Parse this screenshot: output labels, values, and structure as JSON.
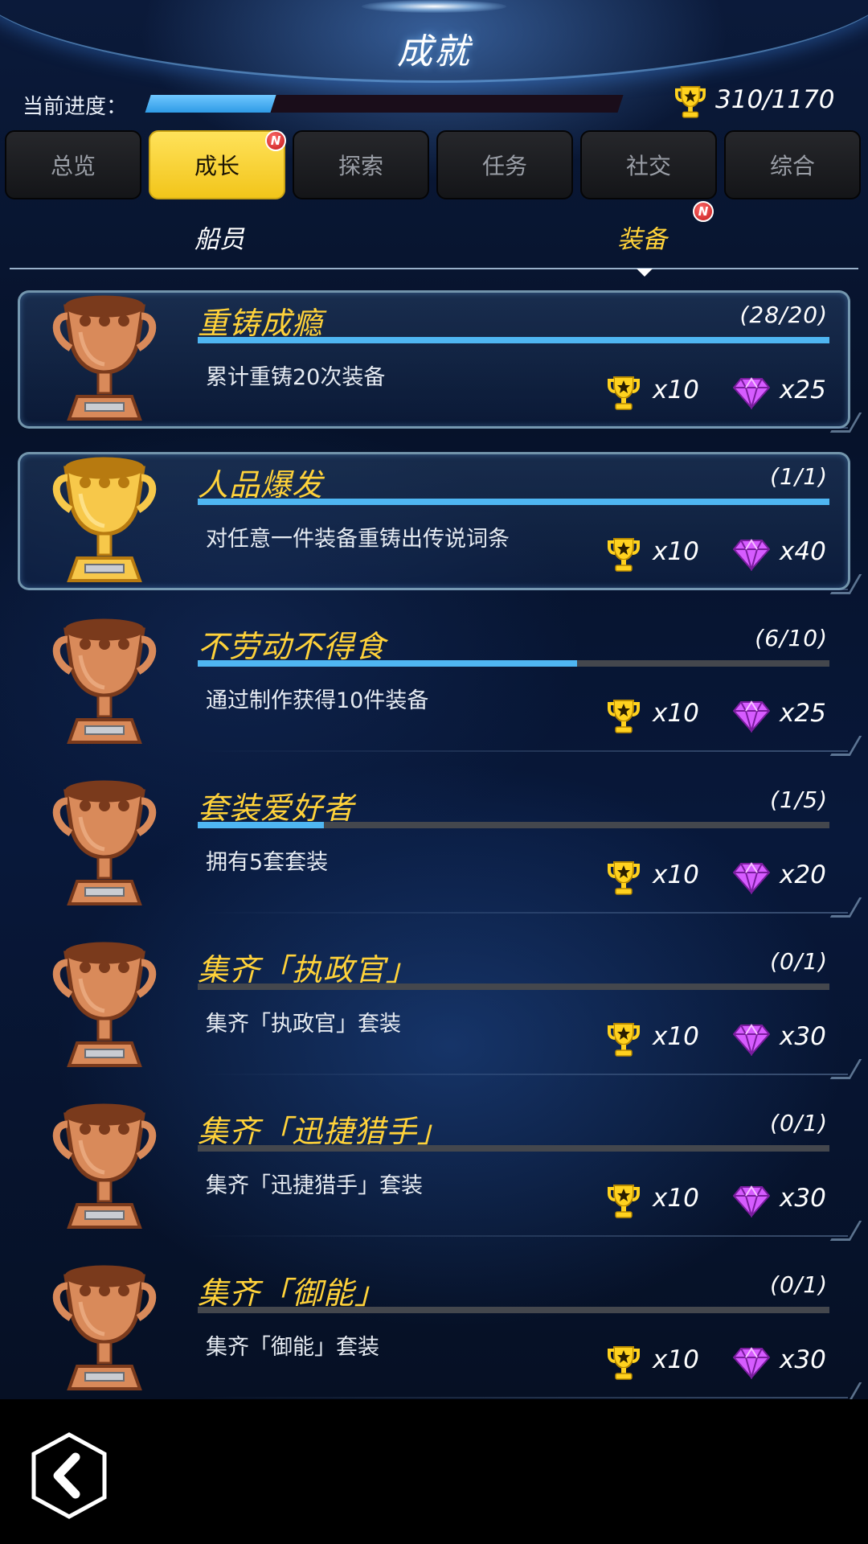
{
  "header": {
    "title": "成就"
  },
  "progress": {
    "label": "当前进度：",
    "current": 310,
    "total": 1170,
    "text": "310/1170",
    "fraction": 0.265
  },
  "tabs": [
    {
      "label": "总览",
      "active": false,
      "badge": ""
    },
    {
      "label": "成长",
      "active": true,
      "badge": "N"
    },
    {
      "label": "探索",
      "active": false,
      "badge": ""
    },
    {
      "label": "任务",
      "active": false,
      "badge": ""
    },
    {
      "label": "社交",
      "active": false,
      "badge": ""
    },
    {
      "label": "综合",
      "active": false,
      "badge": ""
    }
  ],
  "subtabs": [
    {
      "label": "船员",
      "active": false,
      "badge": ""
    },
    {
      "label": "装备",
      "active": true,
      "badge": "N"
    }
  ],
  "achievements": [
    {
      "title": "重铸成瘾",
      "count": "(28/20)",
      "progress": 1.0,
      "desc": "累计重铸20次装备",
      "trophy_reward": "x10",
      "gem_reward": "x25",
      "trophy": "bronze",
      "completed": true
    },
    {
      "title": "人品爆发",
      "count": "(1/1)",
      "progress": 1.0,
      "desc": "对任意一件装备重铸出传说词条",
      "trophy_reward": "x10",
      "gem_reward": "x40",
      "trophy": "gold",
      "completed": true
    },
    {
      "title": "不劳动不得食",
      "count": "(6/10)",
      "progress": 0.6,
      "desc": "通过制作获得10件装备",
      "trophy_reward": "x10",
      "gem_reward": "x25",
      "trophy": "bronze",
      "completed": false
    },
    {
      "title": "套装爱好者",
      "count": "(1/5)",
      "progress": 0.2,
      "desc": "拥有5套套装",
      "trophy_reward": "x10",
      "gem_reward": "x20",
      "trophy": "bronze",
      "completed": false
    },
    {
      "title": "集齐「执政官」",
      "count": "(0/1)",
      "progress": 0,
      "desc": "集齐「执政官」套装",
      "trophy_reward": "x10",
      "gem_reward": "x30",
      "trophy": "bronze",
      "completed": false
    },
    {
      "title": "集齐「迅捷猎手」",
      "count": "(0/1)",
      "progress": 0,
      "desc": "集齐「迅捷猎手」套装",
      "trophy_reward": "x10",
      "gem_reward": "x30",
      "trophy": "bronze",
      "completed": false
    },
    {
      "title": "集齐「御能」",
      "count": "(0/1)",
      "progress": 0,
      "desc": "集齐「御能」套装",
      "trophy_reward": "x10",
      "gem_reward": "x30",
      "trophy": "bronze",
      "completed": false
    }
  ],
  "icons": {
    "reward_trophy": "trophy-star-icon",
    "reward_gem": "gem-icon",
    "back": "back-arrow-icon"
  },
  "colors": {
    "accent": "#ffd23a",
    "progress": "#4fb6f2",
    "gem": "#d65cff",
    "bronze": "#b8673a",
    "gold": "#e8a820"
  }
}
